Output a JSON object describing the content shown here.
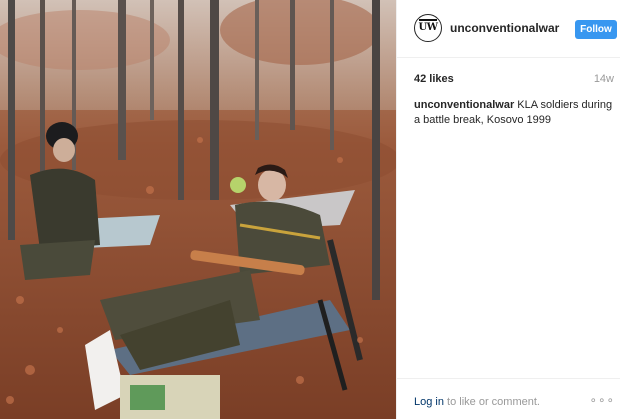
{
  "post": {
    "username": "unconventionalwar",
    "avatar_text": "UW",
    "follow_label": "Follow",
    "likes": "42 likes",
    "age": "14w",
    "caption_text": " KLA soldiers during a battle break, Kosovo 1999",
    "login_label": "Log in",
    "login_suffix": " to like or comment.",
    "more_glyph": "∘∘∘"
  },
  "colors": {
    "follow_button": "#3897f0",
    "link": "#003569",
    "muted": "#999999"
  },
  "icons": {
    "more": "more-options-icon",
    "avatar": "uw-logo-avatar"
  }
}
